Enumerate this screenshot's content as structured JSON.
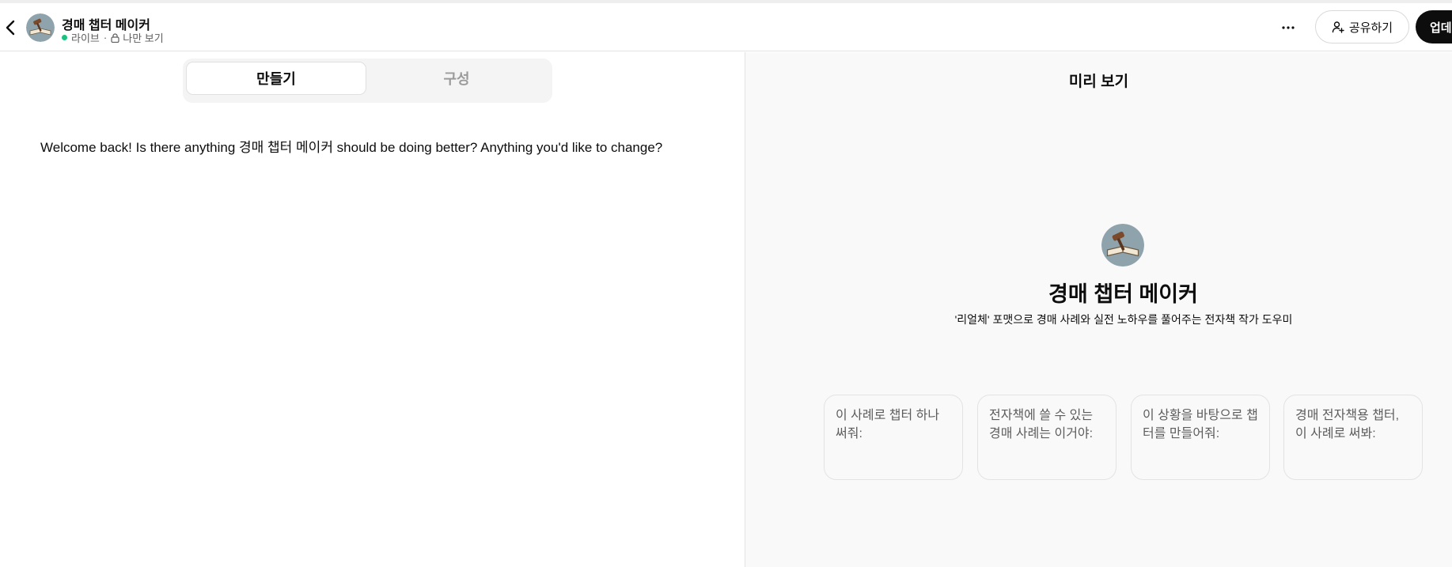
{
  "header": {
    "title": "경매 챕터 메이커",
    "status": "라이브",
    "separator": "·",
    "visibility": "나만 보기",
    "share_label": "공유하기",
    "update_label": "업데이트",
    "more_label": "···"
  },
  "tabs": [
    {
      "label": "만들기",
      "active": true
    },
    {
      "label": "구성",
      "active": false
    }
  ],
  "builder": {
    "message": "Welcome back! Is there anything 경매 챕터 메이커 should be doing better? Anything you'd like to change?"
  },
  "preview": {
    "title": "미리 보기",
    "name": "경매 챕터 메이커",
    "description": "'리얼체' 포맷으로 경매 사례와 실전 노하우를 풀어주는 전자책 작가 도우미",
    "starters": [
      "이 사례로 챕터 하나 써줘:",
      "전자책에 쓸 수 있는 경매 사례는 이거야:",
      "이 상황을 바탕으로 챕터를 만들어줘:",
      "경매 전자책용 챕터, 이 사례로 써봐:"
    ]
  },
  "colors": {
    "status_dot": "#19c37d",
    "accent_button": "#0d0d0d",
    "preview_background": "#f9f9f9"
  },
  "icons": [
    "chevron-left-icon",
    "gpt-avatar-icon",
    "lock-icon",
    "more-icon",
    "share-person-icon"
  ]
}
